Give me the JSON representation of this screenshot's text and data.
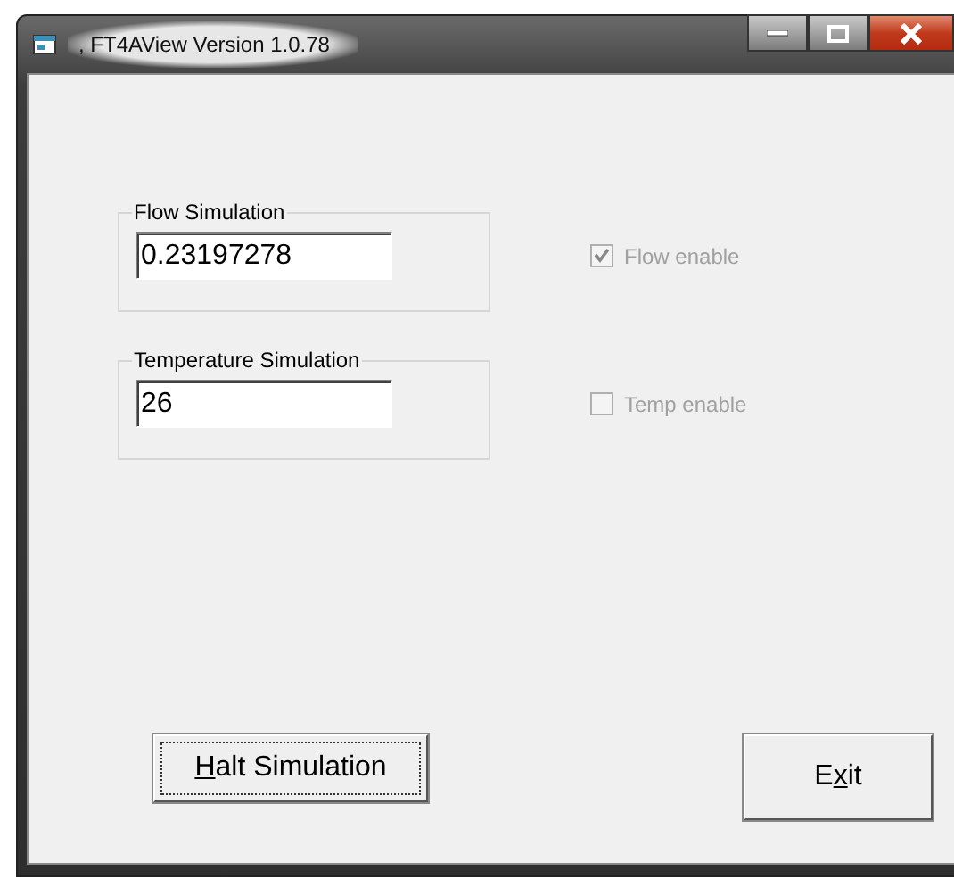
{
  "window": {
    "title": ", FT4AView Version 1.0.78"
  },
  "groups": [
    {
      "label": "Flow Simulation",
      "value": "0.23197278",
      "checkbox": {
        "label": "Flow enable",
        "checked": true,
        "disabled": true
      }
    },
    {
      "label": "Temperature Simulation",
      "value": "26",
      "checkbox": {
        "label": "Temp enable",
        "checked": false,
        "disabled": true
      }
    }
  ],
  "buttons": [
    {
      "key": "H",
      "after": "alt Simulation",
      "focused": true
    },
    {
      "before": "E",
      "key": "x",
      "after": "it",
      "focused": false
    }
  ]
}
